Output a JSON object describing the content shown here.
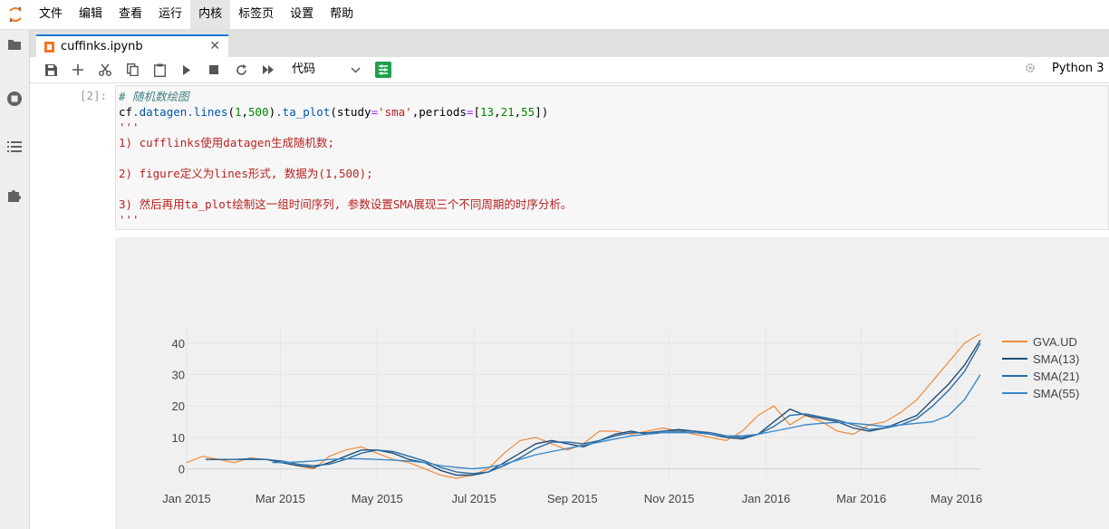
{
  "menubar": {
    "items": [
      "文件",
      "编辑",
      "查看",
      "运行",
      "内核",
      "标签页",
      "设置",
      "帮助"
    ],
    "active_index": 4
  },
  "sidebar": {
    "icons": [
      "folder-icon",
      "running-icon",
      "toc-icon",
      "extension-icon"
    ]
  },
  "tab": {
    "title": "cuffinks.ipynb",
    "close": "✕"
  },
  "toolbar": {
    "cell_type": "代码",
    "kernel_name": "Python 3"
  },
  "cell": {
    "prompt": "[2]:",
    "lines": [
      "# 随机数绘图",
      "cf.datagen.lines(1,500).ta_plot(study='sma',periods=[13,21,55])",
      "'''",
      "1) cufflinks使用datagen生成随机数;",
      "",
      "2) figure定义为lines形式, 数据为(1,500);",
      "",
      "3) 然后再用ta_plot绘制这一组时间序列, 参数设置SMA展现三个不同周期的时序分析。",
      "'''"
    ]
  },
  "colors": {
    "accent": "#1976d2",
    "series_gva": "#f28b3b",
    "series_sma13": "#1f4e79",
    "series_sma21": "#2b6ca3",
    "series_sma55": "#3a88c8"
  },
  "chart_data": {
    "type": "line",
    "x_tick_labels": [
      "Jan 2015",
      "Mar 2015",
      "May 2015",
      "Jul 2015",
      "Sep 2015",
      "Nov 2015",
      "Jan 2016",
      "Mar 2016",
      "May 2016"
    ],
    "y_tick_labels": [
      "0",
      "10",
      "20",
      "30",
      "40"
    ],
    "ylim": [
      -3,
      44
    ],
    "legend_position": "right",
    "grid": true,
    "series": [
      {
        "name": "GVA.UD",
        "color": "#f28b3b",
        "x": [
          0,
          10,
          20,
          30,
          40,
          50,
          60,
          70,
          80,
          90,
          100,
          110,
          120,
          130,
          140,
          150,
          160,
          170,
          180,
          190,
          200,
          210,
          220,
          230,
          240,
          250,
          260,
          270,
          280,
          290,
          300,
          310,
          320,
          330,
          340,
          350,
          360,
          370,
          380,
          390,
          400,
          410,
          420,
          430,
          440,
          450,
          460,
          470,
          480,
          490,
          500
        ],
        "y": [
          2,
          4,
          3,
          2,
          3.5,
          3,
          2,
          1,
          0,
          4,
          6,
          7,
          5,
          3,
          2,
          0,
          -2,
          -3,
          -2,
          0,
          5,
          9,
          10,
          8,
          6,
          8,
          12,
          12,
          11,
          12,
          13,
          12,
          11,
          10,
          9,
          12,
          17,
          20,
          14,
          17,
          15,
          12,
          11,
          14,
          15,
          18,
          22,
          28,
          34,
          40,
          43
        ]
      },
      {
        "name": "SMA(13)",
        "color": "#1f4e79",
        "x": [
          12,
          20,
          30,
          40,
          50,
          60,
          70,
          80,
          90,
          100,
          110,
          120,
          130,
          140,
          150,
          160,
          170,
          180,
          190,
          200,
          210,
          220,
          230,
          240,
          250,
          260,
          270,
          280,
          290,
          300,
          310,
          320,
          330,
          340,
          350,
          360,
          370,
          380,
          390,
          400,
          410,
          420,
          430,
          440,
          450,
          460,
          470,
          480,
          490,
          500
        ],
        "y": [
          3,
          3,
          3,
          3,
          3,
          2,
          1,
          0.5,
          2,
          4,
          6,
          6,
          5,
          3,
          2,
          -0.5,
          -2,
          -2,
          -1,
          2,
          5,
          8,
          9,
          8,
          7,
          9,
          11,
          12,
          11,
          12,
          12.5,
          12,
          11,
          10,
          9.5,
          11,
          15,
          19,
          17,
          16,
          15,
          13,
          12,
          13,
          15,
          17,
          22,
          27,
          33,
          41
        ]
      },
      {
        "name": "SMA(21)",
        "color": "#2b6ca3",
        "x": [
          20,
          30,
          40,
          50,
          60,
          70,
          80,
          90,
          100,
          110,
          120,
          130,
          140,
          150,
          160,
          170,
          180,
          190,
          200,
          210,
          220,
          230,
          240,
          250,
          260,
          270,
          280,
          290,
          300,
          310,
          320,
          330,
          340,
          350,
          360,
          370,
          380,
          390,
          400,
          410,
          420,
          430,
          440,
          450,
          460,
          470,
          480,
          490,
          500
        ],
        "y": [
          3,
          3,
          3.2,
          3,
          2.5,
          1.5,
          1,
          1.5,
          3,
          5,
          6,
          5.5,
          4,
          2.5,
          0.5,
          -1,
          -1.5,
          -1,
          1,
          3.5,
          6.5,
          8.5,
          8.5,
          8,
          9,
          10.5,
          11.5,
          11.5,
          12,
          12,
          12,
          11.5,
          10.5,
          10,
          11,
          13.5,
          17,
          17.5,
          16.5,
          15.5,
          14,
          12.5,
          13,
          14,
          16,
          20,
          25,
          31,
          40
        ]
      },
      {
        "name": "SMA(55)",
        "color": "#3a88c8",
        "x": [
          54,
          60,
          70,
          80,
          90,
          100,
          110,
          120,
          130,
          140,
          150,
          160,
          170,
          180,
          190,
          200,
          210,
          220,
          230,
          240,
          250,
          260,
          270,
          280,
          290,
          300,
          310,
          320,
          330,
          340,
          350,
          360,
          370,
          380,
          390,
          400,
          410,
          420,
          430,
          440,
          450,
          460,
          470,
          480,
          490,
          500
        ],
        "y": [
          2,
          2,
          2.2,
          2.5,
          3,
          3.2,
          3.2,
          3,
          2.8,
          2.5,
          2,
          1,
          0.5,
          0,
          0.5,
          1.5,
          3,
          4.5,
          5.5,
          6.5,
          7.5,
          8.5,
          9.5,
          10.5,
          11,
          11.5,
          11.5,
          11.5,
          11,
          10.5,
          10.5,
          11,
          12,
          13,
          14,
          14.5,
          14.8,
          14.5,
          14,
          13.5,
          14,
          14.5,
          15,
          17,
          22,
          30
        ]
      }
    ],
    "x_domain": [
      0,
      500
    ],
    "x_tick_positions": [
      0,
      59,
      120,
      181,
      243,
      304,
      365,
      425,
      485
    ]
  }
}
